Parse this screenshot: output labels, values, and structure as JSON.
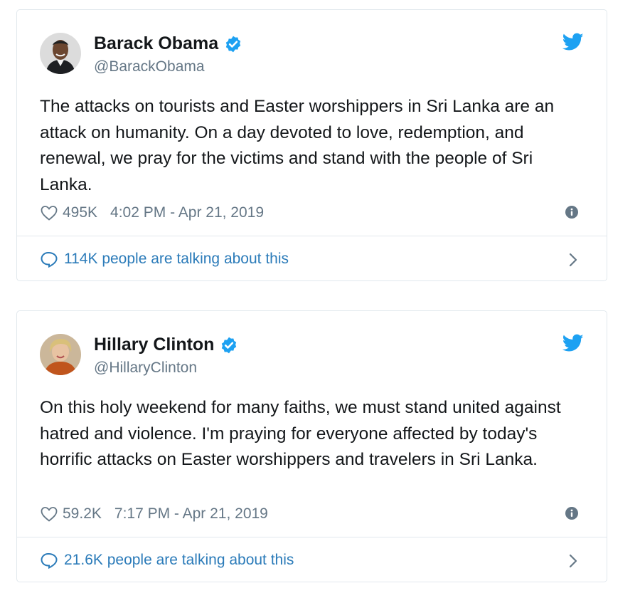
{
  "tweets": [
    {
      "name": "Barack Obama",
      "handle": "@BarackObama",
      "verified": true,
      "avatar": "barack-obama-avatar",
      "text": "The attacks on tourists and Easter worshippers in Sri Lanka are an attack on humanity. On a day devoted to love, redemption, and renewal, we pray for the victims and stand with the people of Sri Lanka.",
      "likes": "495K",
      "timestamp": "4:02 PM - Apr 21, 2019",
      "talking": "114K people are talking about this"
    },
    {
      "name": "Hillary Clinton",
      "handle": "@HillaryClinton",
      "verified": true,
      "avatar": "hillary-clinton-avatar",
      "text": "On this holy weekend for many faiths, we must stand united against hatred and violence. I'm praying for everyone affected by today's horrific attacks on Easter worshippers and travelers in Sri Lanka.",
      "likes": "59.2K",
      "timestamp": "7:17 PM - Apr 21, 2019",
      "talking": "21.6K people are talking about this"
    }
  ],
  "colors": {
    "twitter_blue": "#1da1f2",
    "link_blue": "#2b7bb9",
    "meta_gray": "#657786",
    "border": "#e1e8ed"
  },
  "icons": [
    "verified-badge-icon",
    "twitter-bird-icon",
    "heart-icon",
    "info-icon",
    "reply-bubble-icon",
    "chevron-right-icon"
  ]
}
